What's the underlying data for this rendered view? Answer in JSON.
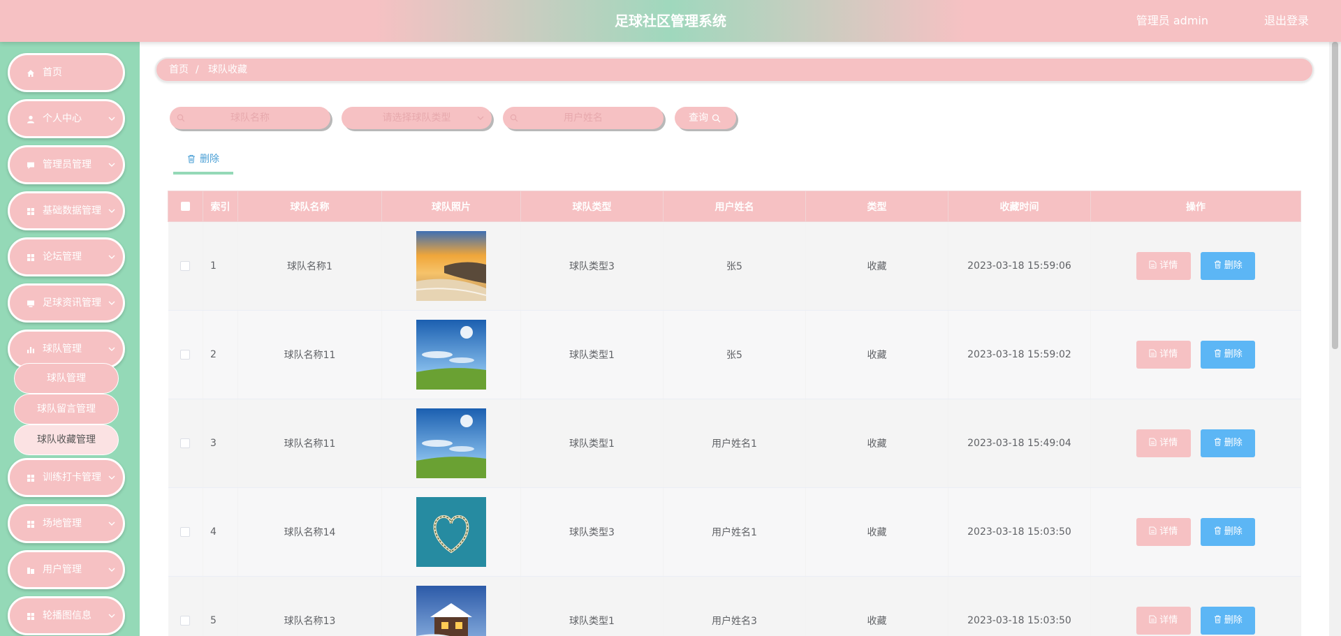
{
  "header": {
    "title": "足球社区管理系统",
    "admin_label": "管理员 admin",
    "logout_label": "退出登录"
  },
  "sidebar": {
    "items": [
      {
        "label": "首页",
        "icon": "home-icon"
      },
      {
        "label": "个人中心",
        "icon": "user-icon"
      },
      {
        "label": "管理员管理",
        "icon": "chat-icon"
      },
      {
        "label": "基础数据管理",
        "icon": "grid-icon"
      },
      {
        "label": "论坛管理",
        "icon": "grid-icon"
      },
      {
        "label": "足球资讯管理",
        "icon": "monitor-icon"
      },
      {
        "label": "球队管理",
        "icon": "bar-chart-icon"
      },
      {
        "label": "训练打卡管理",
        "icon": "grid-icon"
      },
      {
        "label": "场地管理",
        "icon": "grid-icon"
      },
      {
        "label": "用户管理",
        "icon": "building-icon"
      },
      {
        "label": "轮播图信息",
        "icon": "grid-icon"
      }
    ],
    "submenu": [
      {
        "label": "球队管理"
      },
      {
        "label": "球队留言管理"
      },
      {
        "label": "球队收藏管理"
      }
    ]
  },
  "breadcrumb": {
    "home": "首页",
    "separator": "/",
    "current": "球队收藏"
  },
  "search": {
    "team_name_placeholder": "球队名称",
    "team_type_placeholder": "请选择球队类型",
    "user_name_placeholder": "用户姓名",
    "query_label": "查询"
  },
  "toolbar": {
    "delete_label": "删除"
  },
  "table": {
    "headers": {
      "index": "索引",
      "team_name": "球队名称",
      "team_photo": "球队照片",
      "team_type": "球队类型",
      "user_name": "用户姓名",
      "type": "类型",
      "collect_time": "收藏时间",
      "actions": "操作"
    },
    "detail_label": "详情",
    "delete_label": "删除",
    "rows": [
      {
        "index": "1",
        "team_name": "球队名称1",
        "photo": "sunset-beach",
        "team_type": "球队类型3",
        "user_name": "张5",
        "type": "收藏",
        "collect_time": "2023-03-18 15:59:06"
      },
      {
        "index": "2",
        "team_name": "球队名称11",
        "photo": "sky-meadow",
        "team_type": "球队类型1",
        "user_name": "张5",
        "type": "收藏",
        "collect_time": "2023-03-18 15:59:02"
      },
      {
        "index": "3",
        "team_name": "球队名称11",
        "photo": "sky-meadow",
        "team_type": "球队类型1",
        "user_name": "用户姓名1",
        "type": "收藏",
        "collect_time": "2023-03-18 15:49:04"
      },
      {
        "index": "4",
        "team_name": "球队名称14",
        "photo": "heart-island",
        "team_type": "球队类型3",
        "user_name": "用户姓名1",
        "type": "收藏",
        "collect_time": "2023-03-18 15:03:50"
      },
      {
        "index": "5",
        "team_name": "球队名称13",
        "photo": "snow-cabin",
        "team_type": "球队类型1",
        "user_name": "用户姓名3",
        "type": "收藏",
        "collect_time": "2023-03-18 15:03:50"
      }
    ]
  },
  "colors": {
    "pink": "#f6c1c3",
    "mint": "#94d9b7",
    "blue": "#5cb6f5"
  }
}
